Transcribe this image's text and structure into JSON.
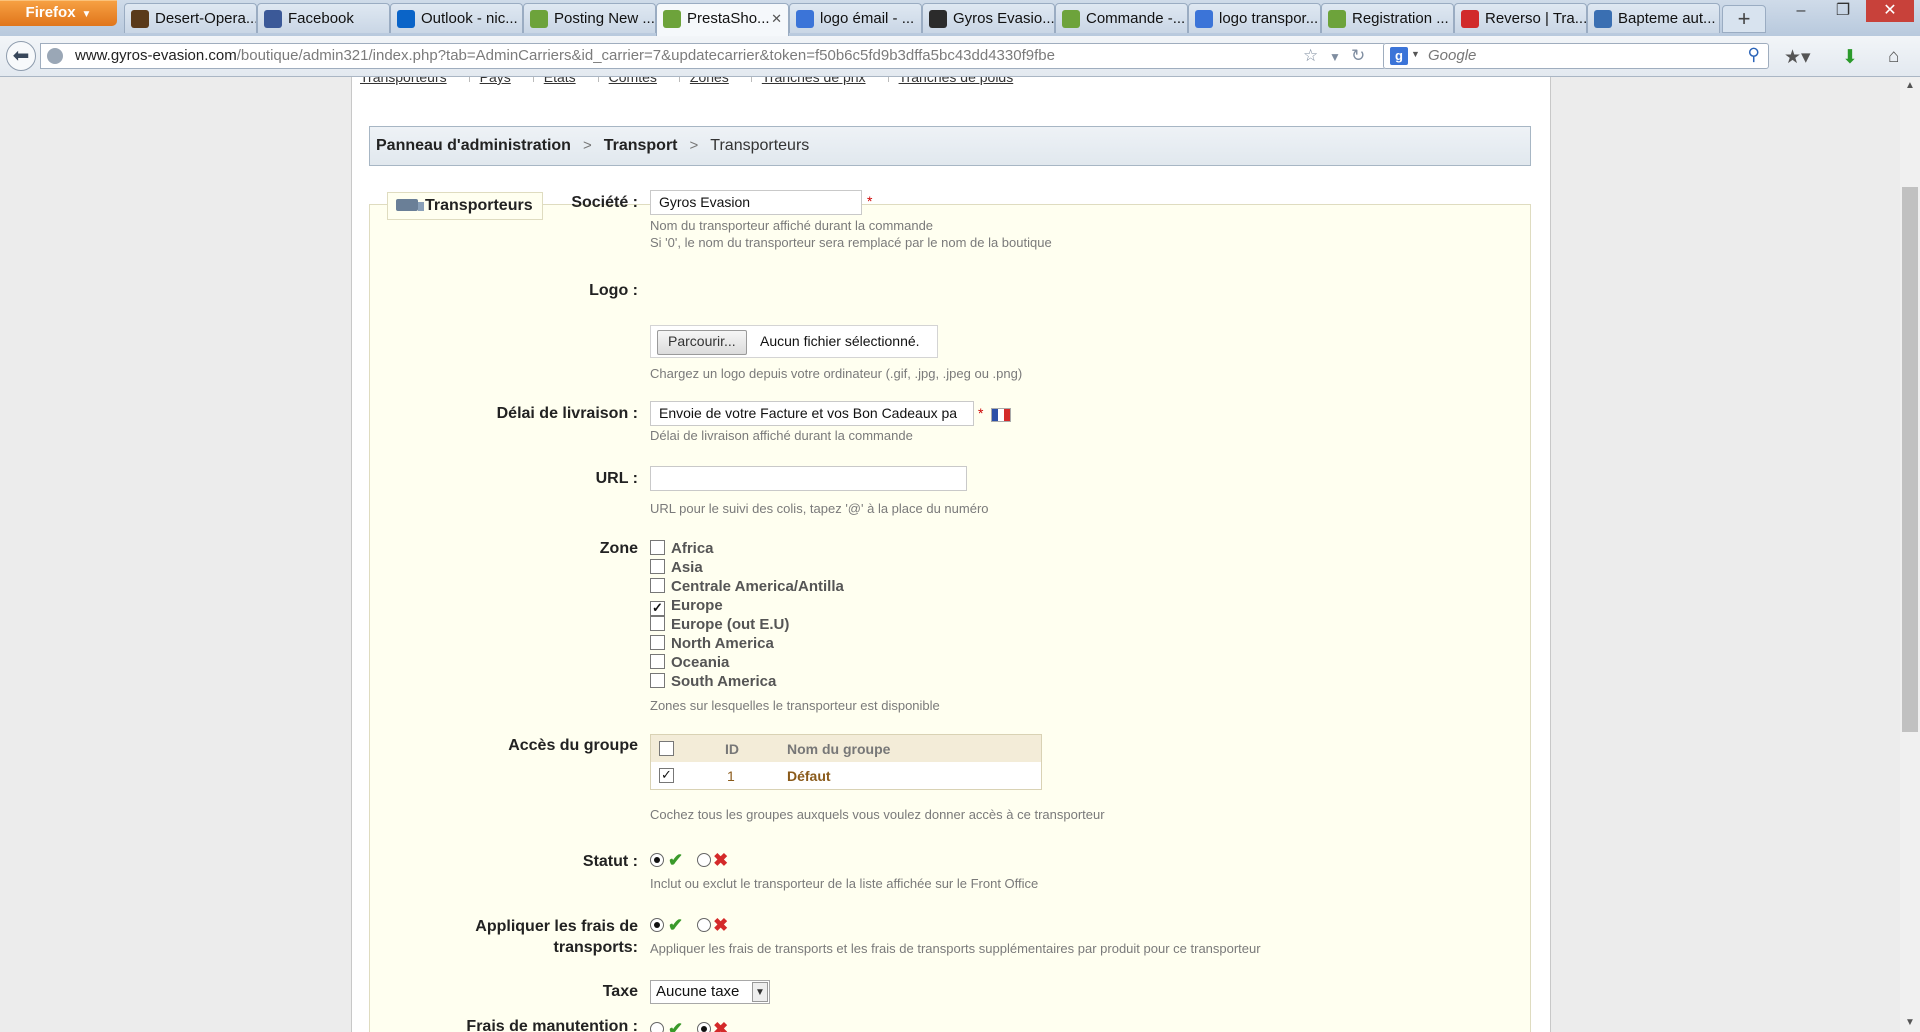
{
  "browser": {
    "menu_button": "Firefox",
    "tabs": [
      {
        "label": "Desert-Opera...",
        "icon": "desert-icon",
        "color": "#5a3a1a"
      },
      {
        "label": "Facebook",
        "icon": "facebook-icon",
        "color": "#3b5998"
      },
      {
        "label": "Outlook - nic...",
        "icon": "outlook-icon",
        "color": "#0a64c8"
      },
      {
        "label": "Posting New ...",
        "icon": "prestashop-icon",
        "color": "#6da33b"
      },
      {
        "label": "PrestaSho...",
        "icon": "prestashop-icon",
        "color": "#6da33b",
        "active": true
      },
      {
        "label": "logo émail - ...",
        "icon": "google-icon",
        "color": "#3b74d8"
      },
      {
        "label": "Gyros Evasio...",
        "icon": "gyros-icon",
        "color": "#2b2b2b"
      },
      {
        "label": "Commande -...",
        "icon": "prestashop-icon",
        "color": "#6da33b"
      },
      {
        "label": "logo transpor...",
        "icon": "google-icon",
        "color": "#3b74d8"
      },
      {
        "label": "Registration ...",
        "icon": "prestashop-icon",
        "color": "#6da33b"
      },
      {
        "label": "Reverso | Tra...",
        "icon": "reverso-icon",
        "color": "#d12a2a"
      },
      {
        "label": "Bapteme aut...",
        "icon": "car-icon",
        "color": "#3a6fb2"
      }
    ],
    "new_tab": "+",
    "url_domain": "www.gyros-evasion.com",
    "url_path": "/boutique/admin321/index.php?tab=AdminCarriers&id_carrier=7&updatecarrier&token=f50b6c5fd9b3dffa5bc43dd4330f9fbe",
    "search_placeholder": "Google",
    "search_engine_letter": "g"
  },
  "subnav": [
    "Transporteurs",
    "Pays",
    "Etats",
    "Comtés",
    "Zones",
    "Tranches de prix",
    "Tranches de poids"
  ],
  "breadcrumb": {
    "root": "Panneau d'administration",
    "section": "Transport",
    "current": "Transporteurs"
  },
  "form": {
    "legend": "Transporteurs",
    "societe": {
      "label": "Société :",
      "value": "Gyros Evasion",
      "hint1": "Nom du transporteur affiché durant la commande",
      "hint2": "Si '0', le nom du transporteur sera remplacé par le nom de la boutique"
    },
    "logo": {
      "label": "Logo :",
      "button": "Parcourir...",
      "file_status": "Aucun fichier sélectionné.",
      "hint": "Chargez un logo depuis votre ordinateur (.gif, .jpg, .jpeg ou .png)"
    },
    "delai": {
      "label": "Délai de livraison :",
      "value": "Envoie de votre Facture et vos Bon Cadeaux pa",
      "hint": "Délai de livraison affiché durant la commande"
    },
    "url": {
      "label": "URL :",
      "value": "",
      "hint": "URL pour le suivi des colis, tapez '@' à la place du numéro"
    },
    "zone": {
      "label": "Zone",
      "items": [
        {
          "name": "Africa",
          "checked": false
        },
        {
          "name": "Asia",
          "checked": false
        },
        {
          "name": "Centrale America/Antilla",
          "checked": false
        },
        {
          "name": "Europe",
          "checked": true
        },
        {
          "name": "Europe (out E.U)",
          "checked": false
        },
        {
          "name": "North America",
          "checked": false
        },
        {
          "name": "Oceania",
          "checked": false
        },
        {
          "name": "South America",
          "checked": false
        }
      ],
      "hint": "Zones sur lesquelles le transporteur est disponible"
    },
    "groupes": {
      "label": "Accès du groupe",
      "col_id": "ID",
      "col_name": "Nom du groupe",
      "row_id": "1",
      "row_name": "Défaut",
      "hint": "Cochez tous les groupes auxquels vous voulez donner accès à ce transporteur"
    },
    "statut": {
      "label": "Statut :",
      "hint": "Inclut ou exclut le transporteur de la liste affichée sur le Front Office"
    },
    "frais": {
      "label1": "Appliquer les frais de",
      "label2": "transports:",
      "hint": "Appliquer les frais de transports et les frais de transports supplémentaires par produit pour ce transporteur"
    },
    "taxe": {
      "label": "Taxe",
      "value": "Aucune taxe"
    },
    "manutention": {
      "label": "Frais de manutention :"
    }
  }
}
